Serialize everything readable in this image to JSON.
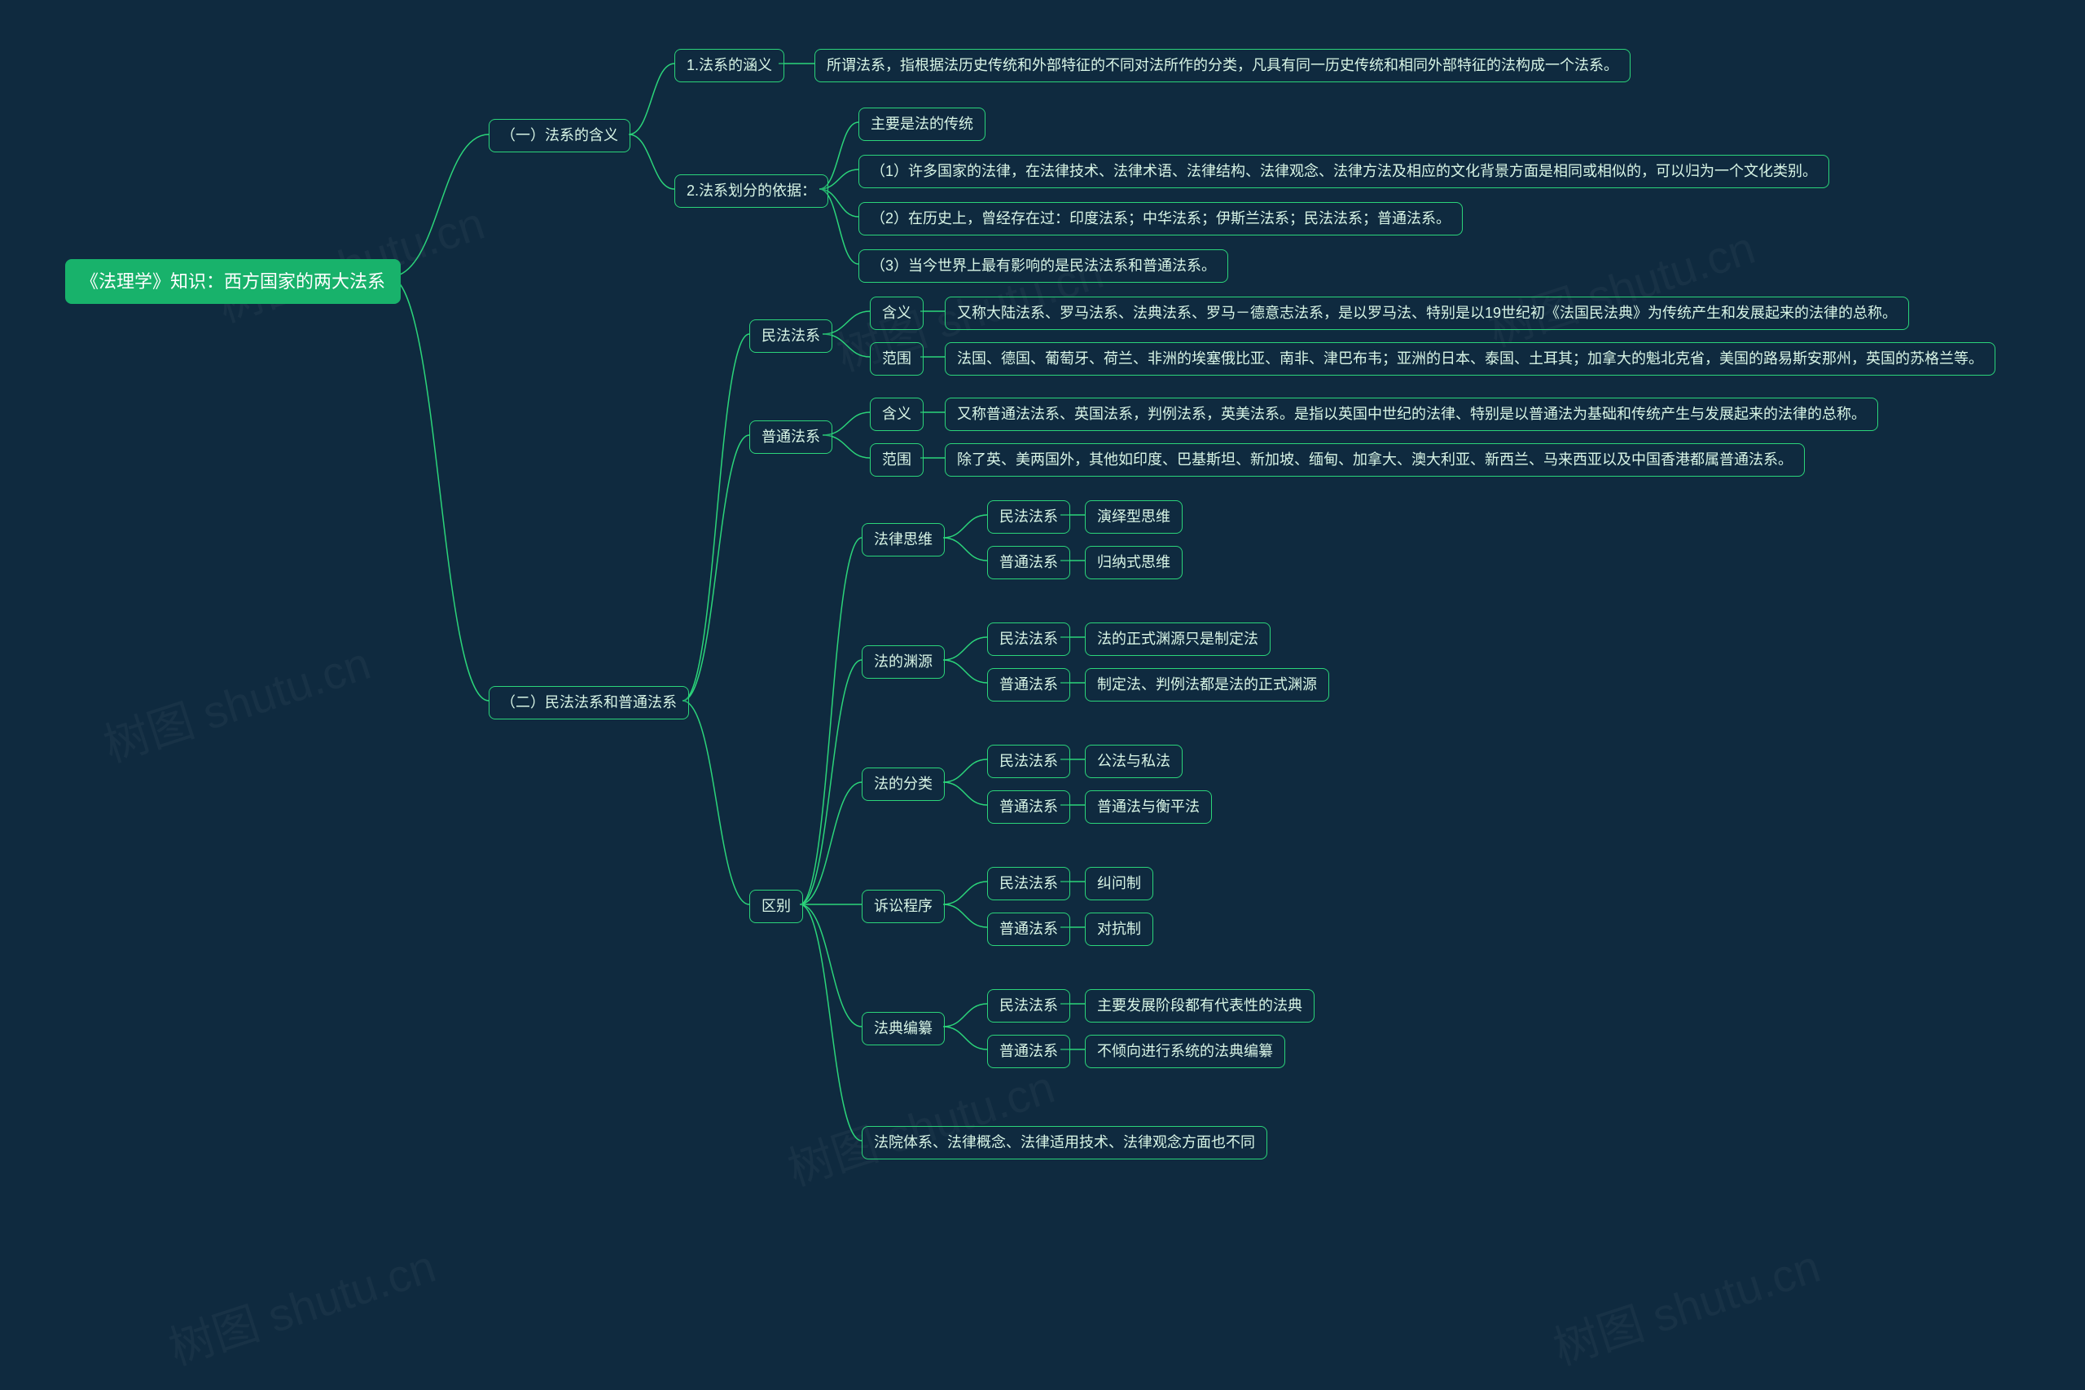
{
  "watermark_text": "树图 shutu.cn",
  "root": "《法理学》知识：西方国家的两大法系",
  "s1": {
    "title": "（一）法系的含义",
    "n1": {
      "label": "1.法系的涵义",
      "text": "所谓法系，指根据法历史传统和外部特征的不同对法所作的分类，凡具有同一历史传统和相同外部特征的法构成一个法系。"
    },
    "n2": {
      "label": "2.法系划分的依据：",
      "a": "主要是法的传统",
      "b": "（1）许多国家的法律，在法律技术、法律术语、法律结构、法律观念、法律方法及相应的文化背景方面是相同或相似的，可以归为一个文化类别。",
      "c": "（2）在历史上，曾经存在过：印度法系；中华法系；伊斯兰法系；民法法系；普通法系。",
      "d": "（3）当今世界上最有影响的是民法法系和普通法系。"
    }
  },
  "s2": {
    "title": "（二）民法法系和普通法系",
    "civil": {
      "label": "民法法系",
      "def_label": "含义",
      "def_text": "又称大陆法系、罗马法系、法典法系、罗马－德意志法系，是以罗马法、特别是以19世纪初《法国民法典》为传统产生和发展起来的法律的总称。",
      "scope_label": "范围",
      "scope_text": "法国、德国、葡萄牙、荷兰、非洲的埃塞俄比亚、南非、津巴布韦；亚洲的日本、泰国、土耳其；加拿大的魁北克省，美国的路易斯安那州，英国的苏格兰等。"
    },
    "common": {
      "label": "普通法系",
      "def_label": "含义",
      "def_text": "又称普通法法系、英国法系，判例法系，英美法系。是指以英国中世纪的法律、特别是以普通法为基础和传统产生与发展起来的法律的总称。",
      "scope_label": "范围",
      "scope_text": "除了英、美两国外，其他如印度、巴基斯坦、新加坡、缅甸、加拿大、澳大利亚、新西兰、马来西亚以及中国香港都属普通法系。"
    },
    "diff": {
      "label": "区别",
      "d1": {
        "label": "法律思维",
        "a_label": "民法法系",
        "a_text": "演绎型思维",
        "b_label": "普通法系",
        "b_text": "归纳式思维"
      },
      "d2": {
        "label": "法的渊源",
        "a_label": "民法法系",
        "a_text": "法的正式渊源只是制定法",
        "b_label": "普通法系",
        "b_text": "制定法、判例法都是法的正式渊源"
      },
      "d3": {
        "label": "法的分类",
        "a_label": "民法法系",
        "a_text": "公法与私法",
        "b_label": "普通法系",
        "b_text": "普通法与衡平法"
      },
      "d4": {
        "label": "诉讼程序",
        "a_label": "民法法系",
        "a_text": "纠问制",
        "b_label": "普通法系",
        "b_text": "对抗制"
      },
      "d5": {
        "label": "法典编纂",
        "a_label": "民法法系",
        "a_text": "主要发展阶段都有代表性的法典",
        "b_label": "普通法系",
        "b_text": "不倾向进行系统的法典编纂"
      },
      "d6": "法院体系、法律概念、法律适用技术、法律观念方面也不同"
    }
  },
  "chart_data": {
    "type": "tree",
    "root": "《法理学》知识：西方国家的两大法系",
    "children": [
      {
        "label": "（一）法系的含义",
        "children": [
          {
            "label": "1.法系的涵义",
            "children": [
              {
                "label": "所谓法系，指根据法历史传统和外部特征的不同对法所作的分类，凡具有同一历史传统和相同外部特征的法构成一个法系。"
              }
            ]
          },
          {
            "label": "2.法系划分的依据：",
            "children": [
              {
                "label": "主要是法的传统"
              },
              {
                "label": "（1）许多国家的法律，在法律技术、法律术语、法律结构、法律观念、法律方法及相应的文化背景方面是相同或相似的，可以归为一个文化类别。"
              },
              {
                "label": "（2）在历史上，曾经存在过：印度法系；中华法系；伊斯兰法系；民法法系；普通法系。"
              },
              {
                "label": "（3）当今世界上最有影响的是民法法系和普通法系。"
              }
            ]
          }
        ]
      },
      {
        "label": "（二）民法法系和普通法系",
        "children": [
          {
            "label": "民法法系",
            "children": [
              {
                "label": "含义",
                "children": [
                  {
                    "label": "又称大陆法系、罗马法系、法典法系、罗马－德意志法系，是以罗马法、特别是以19世纪初《法国民法典》为传统产生和发展起来的法律的总称。"
                  }
                ]
              },
              {
                "label": "范围",
                "children": [
                  {
                    "label": "法国、德国、葡萄牙、荷兰、非洲的埃塞俄比亚、南非、津巴布韦；亚洲的日本、泰国、土耳其；加拿大的魁北克省，美国的路易斯安那州，英国的苏格兰等。"
                  }
                ]
              }
            ]
          },
          {
            "label": "普通法系",
            "children": [
              {
                "label": "含义",
                "children": [
                  {
                    "label": "又称普通法法系、英国法系，判例法系，英美法系。是指以英国中世纪的法律、特别是以普通法为基础和传统产生与发展起来的法律的总称。"
                  }
                ]
              },
              {
                "label": "范围",
                "children": [
                  {
                    "label": "除了英、美两国外，其他如印度、巴基斯坦、新加坡、缅甸、加拿大、澳大利亚、新西兰、马来西亚以及中国香港都属普通法系。"
                  }
                ]
              }
            ]
          },
          {
            "label": "区别",
            "children": [
              {
                "label": "法律思维",
                "children": [
                  {
                    "label": "民法法系",
                    "children": [
                      {
                        "label": "演绎型思维"
                      }
                    ]
                  },
                  {
                    "label": "普通法系",
                    "children": [
                      {
                        "label": "归纳式思维"
                      }
                    ]
                  }
                ]
              },
              {
                "label": "法的渊源",
                "children": [
                  {
                    "label": "民法法系",
                    "children": [
                      {
                        "label": "法的正式渊源只是制定法"
                      }
                    ]
                  },
                  {
                    "label": "普通法系",
                    "children": [
                      {
                        "label": "制定法、判例法都是法的正式渊源"
                      }
                    ]
                  }
                ]
              },
              {
                "label": "法的分类",
                "children": [
                  {
                    "label": "民法法系",
                    "children": [
                      {
                        "label": "公法与私法"
                      }
                    ]
                  },
                  {
                    "label": "普通法系",
                    "children": [
                      {
                        "label": "普通法与衡平法"
                      }
                    ]
                  }
                ]
              },
              {
                "label": "诉讼程序",
                "children": [
                  {
                    "label": "民法法系",
                    "children": [
                      {
                        "label": "纠问制"
                      }
                    ]
                  },
                  {
                    "label": "普通法系",
                    "children": [
                      {
                        "label": "对抗制"
                      }
                    ]
                  }
                ]
              },
              {
                "label": "法典编纂",
                "children": [
                  {
                    "label": "民法法系",
                    "children": [
                      {
                        "label": "主要发展阶段都有代表性的法典"
                      }
                    ]
                  },
                  {
                    "label": "普通法系",
                    "children": [
                      {
                        "label": "不倾向进行系统的法典编纂"
                      }
                    ]
                  }
                ]
              },
              {
                "label": "法院体系、法律概念、法律适用技术、法律观念方面也不同"
              }
            ]
          }
        ]
      }
    ]
  }
}
